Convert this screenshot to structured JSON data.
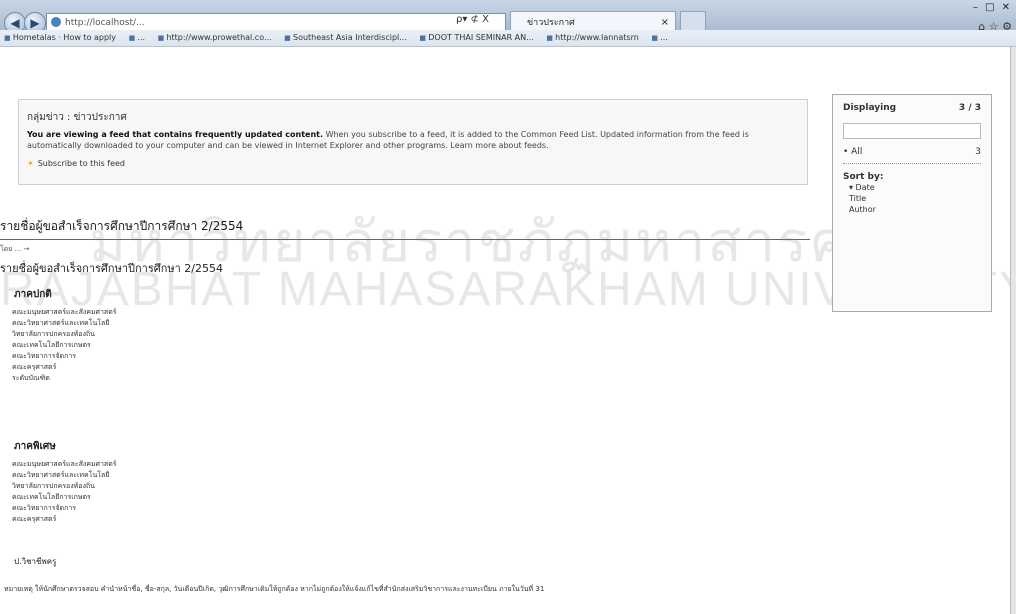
{
  "browser": {
    "address": "http://localhost/...",
    "address_controls": "ρ▾ ⊄ X",
    "active_tab": "ข่าวประกาศ",
    "tab_close": "×",
    "window_controls": "– □ ✕",
    "home_icons": "⌂ ☆ ⚙"
  },
  "favorites": [
    "Hometalas · How to apply",
    "...",
    "http://www.prowethal.co...",
    "Southeast Asia Interdiscipl...",
    "DOOT THAI SEMINAR AN...",
    "http://www.lannatsrn",
    "..."
  ],
  "feed": {
    "title": "กลุ่มข่าว : ข่าวประกาศ",
    "description_bold": "You are viewing a feed that contains frequently updated content.",
    "description": " When you subscribe to a feed, it is added to the Common Feed List. Updated information from the feed is automatically downloaded to your computer and can be viewed in Internet Explorer and other programs. Learn more about feeds.",
    "subscribe_label": "Subscribe to this feed"
  },
  "post": {
    "title": "รายชื่อผู้ขอสำเร็จการศึกษาปีการศึกษา 2/2554",
    "meta": "โดย ... →",
    "subtitle": "รายชื่อผู้ขอสำเร็จการศึกษาปีการศึกษา  2/2554"
  },
  "sections": {
    "day_head": "ภาคปกติ",
    "day_items": [
      "คณะมนุษยศาสตร์และสังคมศาสตร์",
      "คณะวิทยาศาสตร์และเทคโนโลยี",
      "วิทยาลัยการปกครองท้องถิ่น",
      "คณะเทคโนโลยีการเกษตร",
      "คณะวิทยาการจัดการ",
      "คณะครุศาสตร์",
      "ระดับบัณฑิต"
    ],
    "special_head": "ภาคพิเศษ",
    "special_items": [
      "คณะมนุษยศาสตร์และสังคมศาสตร์",
      "คณะวิทยาศาสตร์และเทคโนโลยี",
      "วิทยาลัยการปกครองท้องถิ่น",
      "คณะเทคโนโลยีการเกษตร",
      "คณะวิทยาการจัดการ",
      "คณะครุศาสตร์"
    ],
    "grad_head": "ป.วิชาชีพครู",
    "note": "หมายเหตุ ให้นักศึกษาตรวจสอบ คำนำหน้าชื่อ, ชื่อ-สกุล, วันเดือนปีเกิด, วุฒิการศึกษาเดิมให้ถูกต้อง หากไม่ถูกต้องให้แจ้งแก้ไขที่สำนักส่งเสริมวิชาการและงานทะเบียน ภายในวันที่ 31"
  },
  "sidebar": {
    "displaying_label": "Displaying",
    "displaying_count": "3 / 3",
    "all_label": "• All",
    "all_count": "3",
    "sort_label": "Sort by:",
    "sort_options": [
      "▾ Date",
      "Title",
      "Author"
    ]
  },
  "watermark": {
    "line1": "มหาวิทยาลัยราชภัฏมหาสารคาม",
    "line2": "RAJABHAT MAHASARAKHAM UNIVERSITY"
  }
}
